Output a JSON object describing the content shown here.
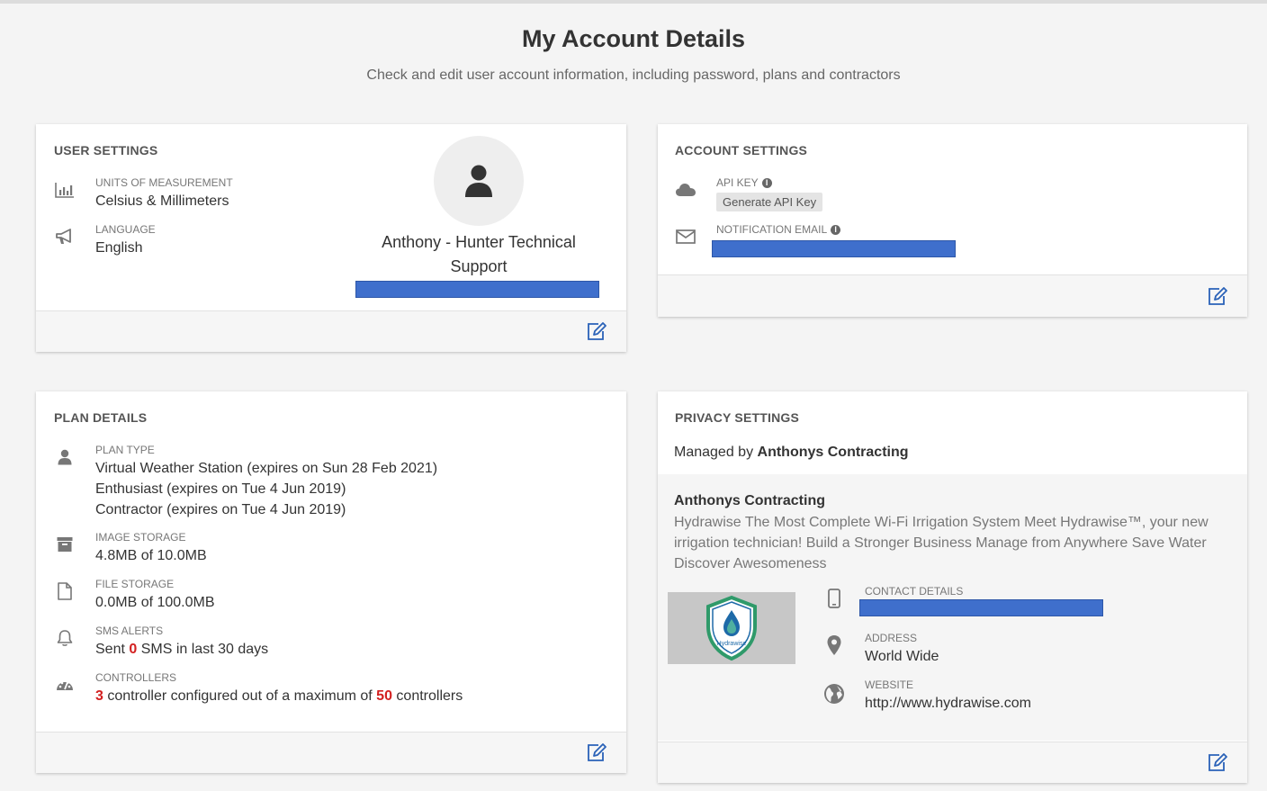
{
  "page": {
    "title": "My Account Details",
    "subtitle": "Check and edit user account information, including password, plans and contractors"
  },
  "colors": {
    "background": "#f4f4f4",
    "card": "#ffffff",
    "redaction": "#3f6fcc",
    "highlight_red": "#d32020",
    "link": "#2a62b8"
  },
  "user_settings": {
    "title": "USER SETTINGS",
    "units_label": "UNITS OF MEASUREMENT",
    "units_value": "Celsius & Millimeters",
    "units_icon": "bar-chart-icon",
    "language_label": "LANGUAGE",
    "language_value": "English",
    "language_icon": "megaphone-icon",
    "profile_name": "Anthony - Hunter Technical Support",
    "avatar_icon": "user-icon",
    "edit_icon": "edit-icon"
  },
  "account_settings": {
    "title": "ACCOUNT SETTINGS",
    "api_key_label": "API KEY",
    "api_key_icon": "cloud-icon",
    "generate_button": "Generate API Key",
    "notification_label": "NOTIFICATION EMAIL",
    "notification_icon": "envelope-icon",
    "info_glyph": "i",
    "edit_icon": "edit-icon"
  },
  "plan_details": {
    "title": "PLAN DETAILS",
    "plan_type_label": "PLAN TYPE",
    "plan_types": [
      "Virtual Weather Station (expires on Sun 28 Feb 2021)",
      "Enthusiast (expires on Tue 4 Jun 2019)",
      "Contractor (expires on Tue 4 Jun 2019)"
    ],
    "image_storage_label": "IMAGE STORAGE",
    "image_storage_value": "4.8MB of 10.0MB",
    "file_storage_label": "FILE STORAGE",
    "file_storage_value": "0.0MB of 100.0MB",
    "sms_label": "SMS ALERTS",
    "sms_prefix": "Sent",
    "sms_count": "0",
    "sms_suffix": "SMS in last 30 days",
    "controllers_label": "CONTROLLERS",
    "controllers_count": "3",
    "controllers_middle": "controller configured out of a maximum of",
    "controllers_max": "50",
    "controllers_suffix": "controllers",
    "edit_icon": "edit-icon"
  },
  "privacy_settings": {
    "title": "PRIVACY SETTINGS",
    "managed_prefix": "Managed by",
    "managed_by": "Anthonys Contracting",
    "contractor_name": "Anthonys Contracting",
    "contractor_description": "Hydrawise The Most Complete Wi-Fi Irrigation System Meet Hydrawise™, your new irrigation technician! Build a Stronger Business Manage from Anywhere Save Water Discover Awesomeness",
    "logo_text": "Hydrawise",
    "contact_label": "CONTACT DETAILS",
    "contact_icon": "mobile-phone-icon",
    "address_label": "ADDRESS",
    "address_value": "World Wide",
    "address_icon": "map-pin-icon",
    "website_label": "WEBSITE",
    "website_value": "http://www.hydrawise.com",
    "website_icon": "globe-icon",
    "edit_icon": "edit-icon"
  }
}
